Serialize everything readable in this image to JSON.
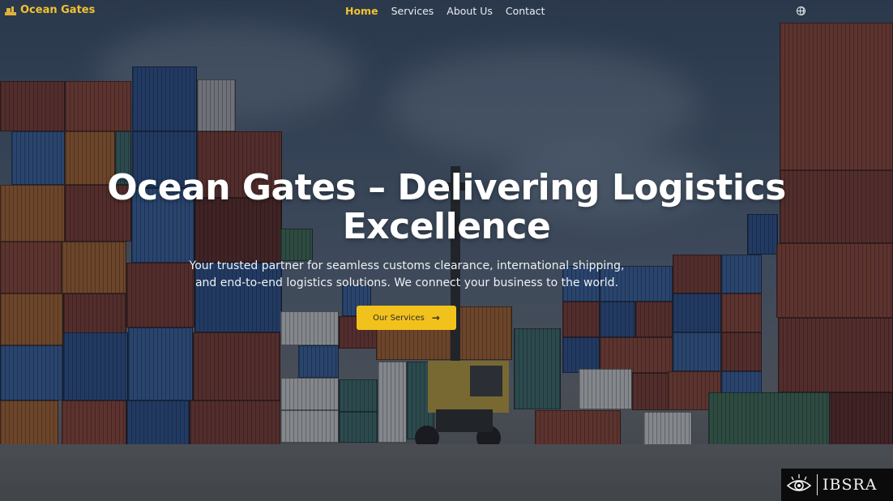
{
  "nav": {
    "brand": "Ocean Gates",
    "links": [
      {
        "label": "Home",
        "active": true
      },
      {
        "label": "Services",
        "active": false
      },
      {
        "label": "About Us",
        "active": false
      },
      {
        "label": "Contact",
        "active": false
      }
    ],
    "language_icon": "globe-icon"
  },
  "hero": {
    "title_line1": "Ocean Gates – Delivering Logistics",
    "title_line2": "Excellence",
    "subtitle_line1": "Your trusted partner for seamless customs clearance, international shipping,",
    "subtitle_line2": "and end-to-end logistics solutions. We connect your business to the world.",
    "cta_label": "Our Services",
    "cta_icon": "arrow-right-icon"
  },
  "watermark": {
    "text": "IBSRA"
  },
  "colors": {
    "accent": "#f2c21c",
    "brand_text": "#f2c230"
  }
}
